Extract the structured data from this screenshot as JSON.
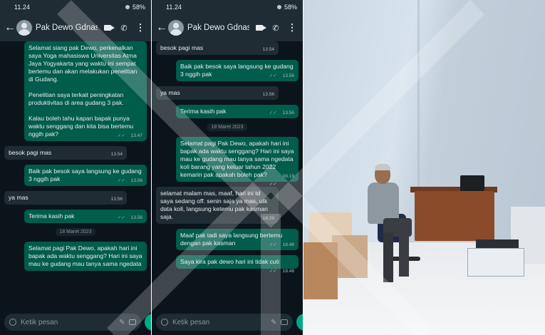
{
  "phone_left": {
    "status_time": "11.24",
    "status_battery": "58%",
    "contact_name": "Pak Dewo Gdnasa",
    "input_placeholder": "Ketik pesan",
    "messages": [
      {
        "kind": "out",
        "text": "Selamat siang pak Dewo, perkenalkan saya Yoga mahasiswa Universitas Atma Jaya Yogyakarta yang waktu ini sempat bertemu dan akan melakukan penelitian di Gudang.\n\nPenelitian saya terkait peningkatan produktivitas di area gudang 3 pak.\n\nKalau boleh tahu kapan bapak punya waktu senggang dan kita bisa bertemu nggih pak?",
        "time": "13.47"
      },
      {
        "kind": "in",
        "text": "besok pagi mas",
        "time": "13.54"
      },
      {
        "kind": "out",
        "text": "Baik pak besok saya langsung ke gudang 3 nggih pak",
        "time": "13.56"
      },
      {
        "kind": "in",
        "text": "ya mas",
        "time": "13.56"
      },
      {
        "kind": "out",
        "text": "Terima kasih pak",
        "time": "13.56"
      },
      {
        "kind": "date",
        "text": "18 Maret 2023"
      },
      {
        "kind": "out",
        "text": "Selamat pagi Pak Dewo, apakah hari ini bapak ada waktu senggang? Hari ini saya mau ke gudang mau tanya sama ngedata",
        "time": ""
      }
    ]
  },
  "phone_right": {
    "status_time": "11.24",
    "status_battery": "58%",
    "contact_name": "Pak Dewo Gdnasa",
    "input_placeholder": "Ketik pesan",
    "messages": [
      {
        "kind": "in",
        "text": "besok pagi mas",
        "time": "13.54"
      },
      {
        "kind": "out",
        "text": "Baik pak besok saya langsung ke gudang 3 nggih pak",
        "time": "13.56"
      },
      {
        "kind": "in",
        "text": "ya mas",
        "time": "13.56"
      },
      {
        "kind": "out",
        "text": "Terima kasih pak",
        "time": "13.56"
      },
      {
        "kind": "date",
        "text": "18 Maret 2023"
      },
      {
        "kind": "out",
        "text": "Selamat pagi Pak Dewo, apakah hari ini bapak ada waktu senggang? Hari ini saya mau ke gudang mau tanya sama ngedata koli barang yang keluar tahun 2022 kemarin pak apakah boleh pak?",
        "time": "08.19"
      },
      {
        "kind": "in",
        "text": "selamat malam mas, maaf, hari ini td saya sedang off. senin saja ya mas, utk data koli, langsung ketemu pak kasman saja.",
        "time": "18.29"
      },
      {
        "kind": "out",
        "text": "Maaf pak tadi saya langsung bertemu dengan pak kasman",
        "time": "18.48"
      },
      {
        "kind": "out",
        "text": "Saya kira pak dewo hari ini tidak cuti",
        "time": "18.48"
      }
    ]
  },
  "colors": {
    "chat_bg": "#0b141a",
    "header_bg": "#1f2c34",
    "bubble_out": "#005c4b",
    "bubble_in": "#202c33",
    "accent": "#00a884"
  }
}
